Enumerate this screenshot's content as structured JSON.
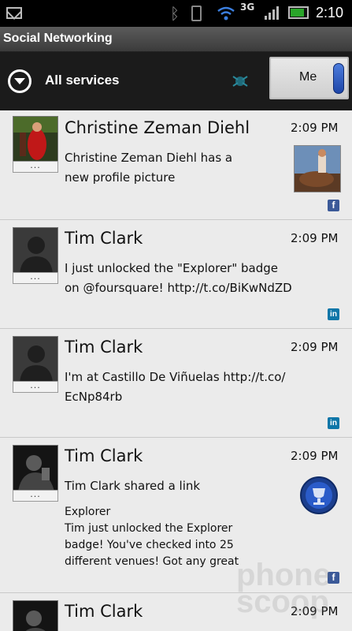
{
  "status_bar": {
    "network_type": "3G",
    "time": "2:10",
    "battery_level": 0.75,
    "icons": [
      "gmail-icon",
      "bluetooth-icon",
      "vibrate-icon",
      "wifi-icon",
      "signal-icon",
      "battery-icon"
    ]
  },
  "title_bar": {
    "title": "Social Networking"
  },
  "toolbar": {
    "services_label": "All services",
    "me_label": "Me"
  },
  "feed": {
    "avatar_menu_label": "...",
    "items": [
      {
        "name": "Christine Zeman Diehl",
        "time": "2:09 PM",
        "text": "Christine Zeman Diehl has a\nnew profile picture",
        "network": "f",
        "network_name": "facebook"
      },
      {
        "name": "Tim Clark",
        "time": "2:09 PM",
        "text": "I just unlocked the \"Explorer\" badge\non @foursquare! http://t.co/BiKwNdZD",
        "network": "in",
        "network_name": "linkedin"
      },
      {
        "name": "Tim Clark",
        "time": "2:09 PM",
        "text": "I'm at Castillo De Viñuelas http://t.co/\nEcNp84rb",
        "network": "in",
        "network_name": "linkedin"
      },
      {
        "name": "Tim Clark",
        "time": "2:09 PM",
        "text": "Tim Clark shared a link",
        "subtext": "Explorer\nTim just unlocked the Explorer\nbadge! You've checked into 25\ndifferent venues! Got any great",
        "network": "f",
        "network_name": "facebook"
      },
      {
        "name": "Tim Clark",
        "time": "2:09 PM"
      }
    ]
  },
  "watermark": {
    "line1": "phone",
    "line2": "scoop"
  },
  "colors": {
    "facebook": "#3b5998",
    "linkedin": "#0e76a8",
    "me_toggle": "#2a5bc9"
  }
}
